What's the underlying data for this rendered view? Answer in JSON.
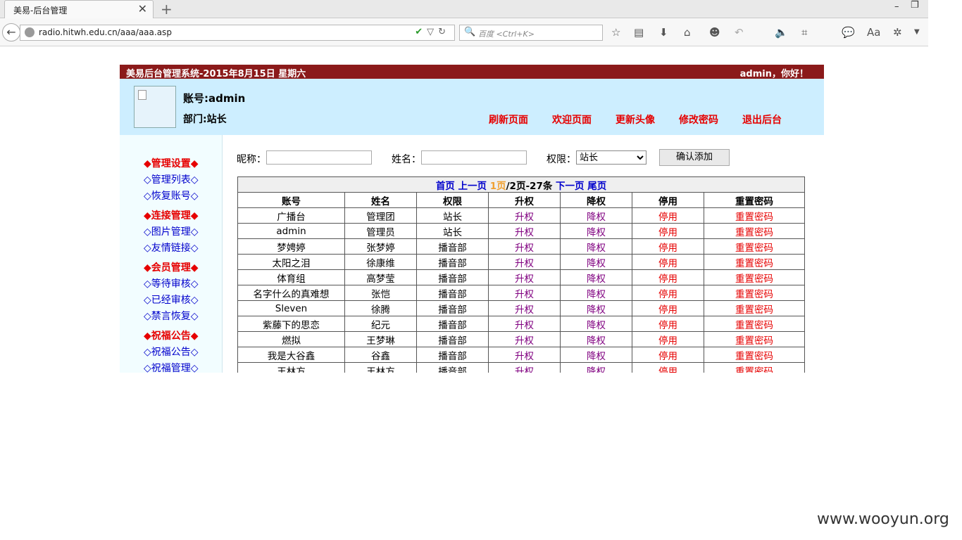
{
  "browser": {
    "tab_title": "美易-后台管理",
    "url": "radio.hitwh.edu.cn/aaa/aaa.asp",
    "search_placeholder": "百度 <Ctrl+K>"
  },
  "topbar": {
    "title": "美易后台管理系统-2015年8月15日 星期六",
    "greeting": "admin，你好！"
  },
  "header": {
    "account": "账号:admin",
    "department": "部门:站长",
    "links": [
      "刷新页面",
      "欢迎页面",
      "更新头像",
      "修改密码",
      "退出后台"
    ]
  },
  "sidebar": {
    "groups": [
      {
        "title": "◆管理设置◆",
        "items": [
          "◇管理列表◇",
          "◇恢复账号◇"
        ]
      },
      {
        "title": "◆连接管理◆",
        "items": [
          "◇图片管理◇",
          "◇友情链接◇"
        ]
      },
      {
        "title": "◆会员管理◆",
        "items": [
          "◇等待审核◇",
          "◇已经审核◇",
          "◇禁言恢复◇"
        ]
      },
      {
        "title": "◆祝福公告◆",
        "items": [
          "◇祝福公告◇",
          "◇祝福管理◇"
        ]
      }
    ]
  },
  "form": {
    "nickname_label": "昵称：",
    "name_label": "姓名：",
    "perm_label": "权限：",
    "perm_selected": "站长",
    "submit": "确认添加"
  },
  "pager": {
    "first": "首页",
    "prev": "上一页",
    "current": "1页",
    "info": "/2页-27条",
    "next": "下一页",
    "last": "尾页"
  },
  "table": {
    "headers": [
      "账号",
      "姓名",
      "权限",
      "升权",
      "降权",
      "停用",
      "重置密码"
    ],
    "rows": [
      [
        "广播台",
        "管理团",
        "站长",
        "升权",
        "降权",
        "停用",
        "重置密码"
      ],
      [
        "admin",
        "管理员",
        "站长",
        "升权",
        "降权",
        "停用",
        "重置密码"
      ],
      [
        "梦娉婷",
        "张梦婷",
        "播音部",
        "升权",
        "降权",
        "停用",
        "重置密码"
      ],
      [
        "太阳之泪",
        "徐康维",
        "播音部",
        "升权",
        "降权",
        "停用",
        "重置密码"
      ],
      [
        "体育组",
        "高梦莹",
        "播音部",
        "升权",
        "降权",
        "停用",
        "重置密码"
      ],
      [
        "名字什么的真难想",
        "张恺",
        "播音部",
        "升权",
        "降权",
        "停用",
        "重置密码"
      ],
      [
        "Sleven",
        "徐腾",
        "播音部",
        "升权",
        "降权",
        "停用",
        "重置密码"
      ],
      [
        "紫藤下的思恋",
        "纪元",
        "播音部",
        "升权",
        "降权",
        "停用",
        "重置密码"
      ],
      [
        "燃拟",
        "王梦琳",
        "播音部",
        "升权",
        "降权",
        "停用",
        "重置密码"
      ],
      [
        "我是大谷鑫",
        "谷鑫",
        "播音部",
        "升权",
        "降权",
        "停用",
        "重置密码"
      ],
      [
        "王林方",
        "王林方",
        "播音部",
        "升权",
        "降权",
        "停用",
        "重置密码"
      ]
    ]
  },
  "watermark": "www.wooyun.org"
}
